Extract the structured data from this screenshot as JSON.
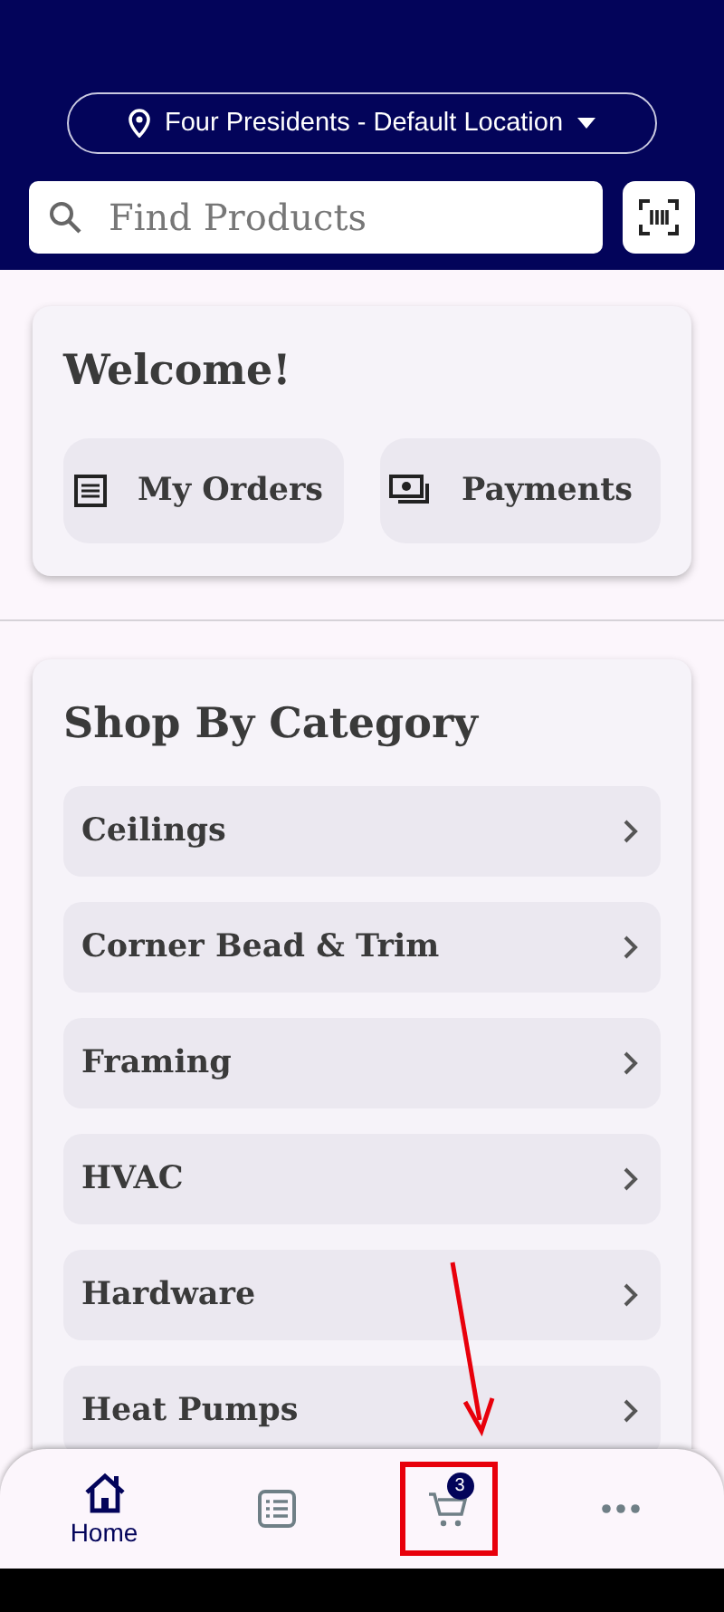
{
  "location": {
    "label": "Four Presidents - Default Location"
  },
  "search": {
    "placeholder": "Find Products"
  },
  "welcome": {
    "title": "Welcome!",
    "actions": [
      {
        "kind": "orders",
        "label": "My Orders"
      },
      {
        "kind": "payments",
        "label": "Payments"
      }
    ]
  },
  "categories": {
    "title": "Shop By Category",
    "items": [
      {
        "label": "Ceilings"
      },
      {
        "label": "Corner Bead & Trim"
      },
      {
        "label": "Framing"
      },
      {
        "label": "HVAC"
      },
      {
        "label": "Hardware"
      },
      {
        "label": "Heat Pumps"
      }
    ]
  },
  "nav": [
    {
      "kind": "home",
      "label": "Home",
      "selected": true,
      "highlighted": false
    },
    {
      "kind": "list",
      "selected": false,
      "highlighted": false
    },
    {
      "kind": "cart",
      "badge": "3",
      "selected": false,
      "highlighted": true
    },
    {
      "kind": "more",
      "selected": false,
      "highlighted": false
    }
  ]
}
